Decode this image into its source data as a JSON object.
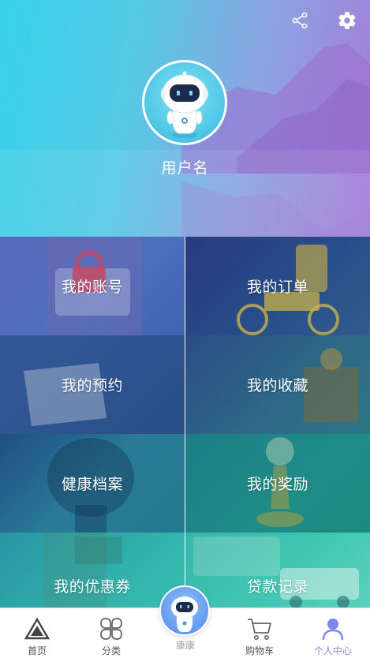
{
  "header": {
    "username": "用户名"
  },
  "menu": [
    {
      "label": "我的账号"
    },
    {
      "label": "我的订单"
    },
    {
      "label": "我的预约"
    },
    {
      "label": "我的收藏"
    },
    {
      "label": "健康档案"
    },
    {
      "label": "我的奖励"
    },
    {
      "label": "我的优惠券"
    },
    {
      "label": "贷款记录"
    }
  ],
  "tabbar": [
    {
      "label": "首页",
      "icon": "triangle-home-icon"
    },
    {
      "label": "分类",
      "icon": "category-icon"
    },
    {
      "label": "康康",
      "icon": "robot-icon"
    },
    {
      "label": "购物车",
      "icon": "cart-icon"
    },
    {
      "label": "个人中心",
      "icon": "person-icon",
      "active": true
    }
  ],
  "colors": {
    "active_tab": "#7e88e8",
    "inactive_tab": "#555555"
  }
}
